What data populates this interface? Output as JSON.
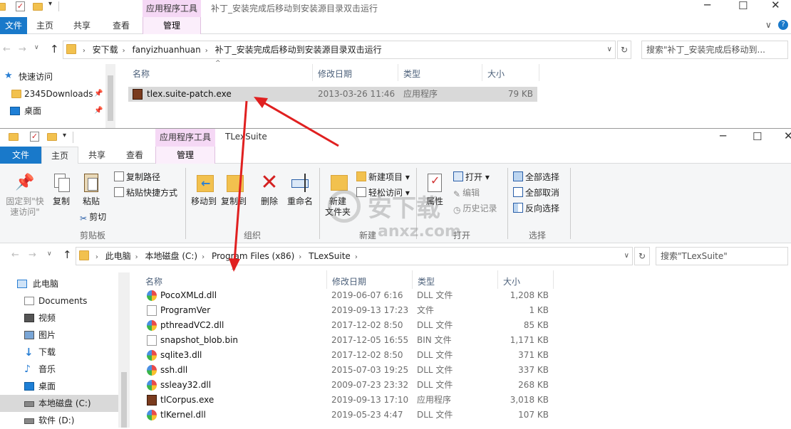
{
  "back_window": {
    "context_tab": "应用程序工具",
    "manage_tab": "管理",
    "title": "补丁_安装完成后移动到安装源目录双击运行",
    "tabs": [
      "文件",
      "主页",
      "共享",
      "查看"
    ],
    "breadcrumb": [
      "安下载",
      "fanyizhuanhuan",
      "补丁_安装完成后移动到安装源目录双击运行"
    ],
    "search_placeholder": "搜索\"补丁_安装完成后移动到...",
    "columns": [
      "名称",
      "修改日期",
      "类型",
      "大小"
    ],
    "nav": [
      {
        "label": "快速访问",
        "icon": "star-icon"
      },
      {
        "label": "2345Downloads",
        "icon": "folder-icon"
      },
      {
        "label": "桌面",
        "icon": "desktop-icon"
      }
    ],
    "files": [
      {
        "name": "tlex.suite-patch.exe",
        "date": "2013-03-26 11:46",
        "type": "应用程序",
        "size": "79 KB"
      }
    ]
  },
  "front_window": {
    "context_tab": "应用程序工具",
    "manage_tab": "管理",
    "title": "TLexSuite",
    "tabs": [
      "文件",
      "主页",
      "共享",
      "查看"
    ],
    "ribbon": {
      "pin_label_1": "固定到\"快",
      "pin_label_2": "速访问\"",
      "copy": "复制",
      "paste": "粘贴",
      "copy_path": "复制路径",
      "paste_shortcut": "粘贴快捷方式",
      "cut": "剪切",
      "clipboard_group": "剪贴板",
      "move_to": "移动到",
      "copy_to": "复制到",
      "delete": "删除",
      "rename": "重命名",
      "organize_group": "组织",
      "new_folder_1": "新建",
      "new_folder_2": "文件夹",
      "new_item": "新建项目",
      "easy_access": "轻松访问",
      "new_group": "新建",
      "properties": "属性",
      "open": "打开",
      "edit": "编辑",
      "history": "历史记录",
      "open_group": "打开",
      "select_all": "全部选择",
      "select_none": "全部取消",
      "invert_select": "反向选择",
      "select_group": "选择"
    },
    "breadcrumb": [
      "此电脑",
      "本地磁盘 (C:)",
      "Program Files (x86)",
      "TLexSuite"
    ],
    "search_placeholder": "搜索\"TLexSuite\"",
    "columns": [
      "名称",
      "修改日期",
      "类型",
      "大小"
    ],
    "nav": [
      {
        "label": "此电脑",
        "icon": "computer-icon"
      },
      {
        "label": "Documents",
        "icon": "documents-icon"
      },
      {
        "label": "视频",
        "icon": "video-icon"
      },
      {
        "label": "图片",
        "icon": "pictures-icon"
      },
      {
        "label": "下载",
        "icon": "download-icon"
      },
      {
        "label": "音乐",
        "icon": "music-icon"
      },
      {
        "label": "桌面",
        "icon": "desktop-icon"
      },
      {
        "label": "本地磁盘 (C:)",
        "icon": "drive-icon"
      },
      {
        "label": "软件 (D:)",
        "icon": "drive-icon"
      }
    ],
    "files": [
      {
        "name": "PocoXMLd.dll",
        "date": "2019-06-07 6:16",
        "type": "DLL 文件",
        "size": "1,208 KB",
        "icon": "dll"
      },
      {
        "name": "ProgramVer",
        "date": "2019-09-13 17:23",
        "type": "文件",
        "size": "1 KB",
        "icon": "txt"
      },
      {
        "name": "pthreadVC2.dll",
        "date": "2017-12-02 8:50",
        "type": "DLL 文件",
        "size": "85 KB",
        "icon": "dll"
      },
      {
        "name": "snapshot_blob.bin",
        "date": "2017-12-05 16:55",
        "type": "BIN 文件",
        "size": "1,171 KB",
        "icon": "txt"
      },
      {
        "name": "sqlite3.dll",
        "date": "2017-12-02 8:50",
        "type": "DLL 文件",
        "size": "371 KB",
        "icon": "dll"
      },
      {
        "name": "ssh.dll",
        "date": "2015-07-03 19:25",
        "type": "DLL 文件",
        "size": "337 KB",
        "icon": "dll"
      },
      {
        "name": "ssleay32.dll",
        "date": "2009-07-23 23:32",
        "type": "DLL 文件",
        "size": "268 KB",
        "icon": "dll"
      },
      {
        "name": "tlCorpus.exe",
        "date": "2019-09-13 17:10",
        "type": "应用程序",
        "size": "3,018 KB",
        "icon": "exe"
      },
      {
        "name": "tlKernel.dll",
        "date": "2019-05-23 4:47",
        "type": "DLL 文件",
        "size": "107 KB",
        "icon": "dll"
      }
    ]
  },
  "watermark": {
    "text": "安下载",
    "sub": "anxz.com"
  },
  "colors": {
    "file_tab": "#1979ca",
    "context_tab": "#f5d8f5",
    "arrow": "#e02020",
    "selection": "#d9d9d9"
  }
}
